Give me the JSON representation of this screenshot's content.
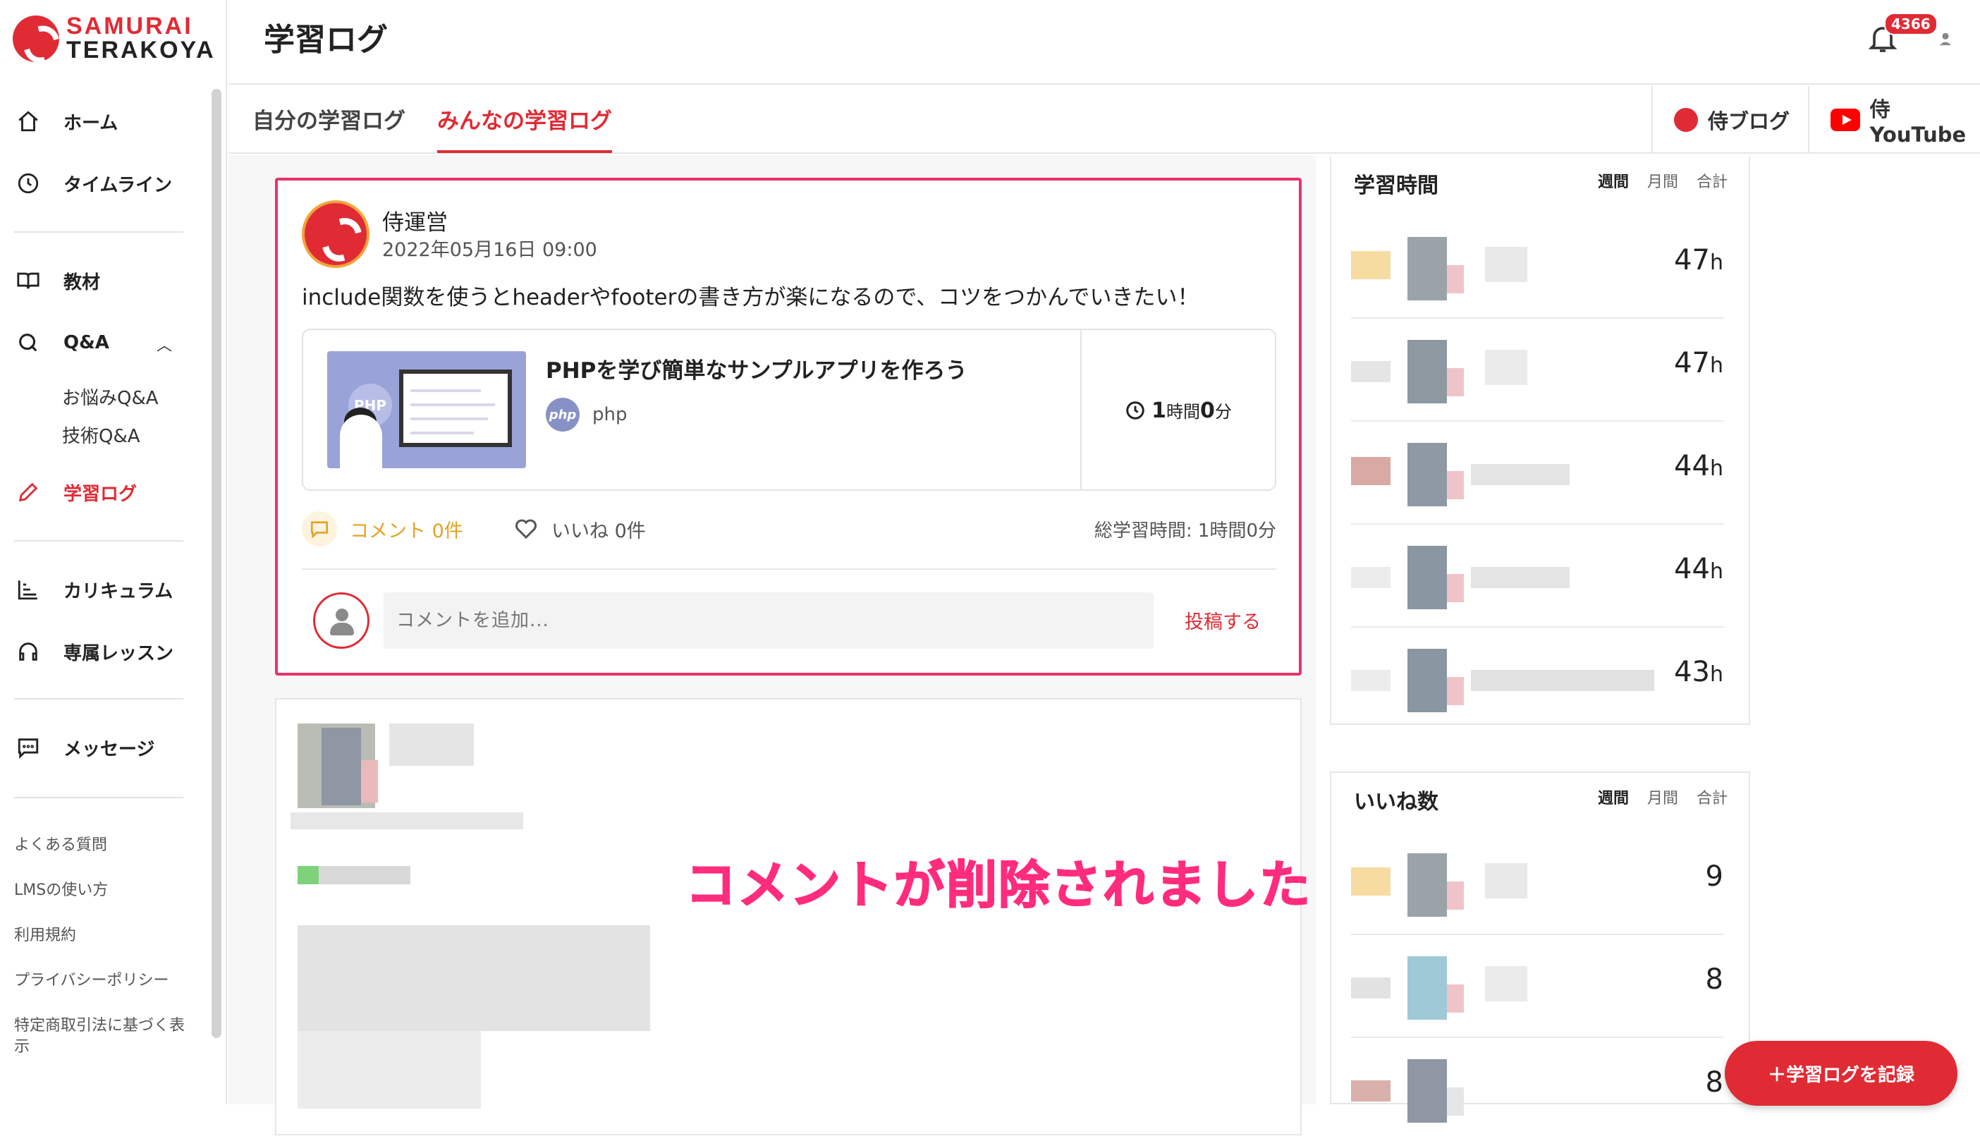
{
  "brand": {
    "line1": "SAMURAI",
    "line2": "TERAKOYA"
  },
  "header": {
    "title": "学習ログ",
    "notification_count": "4366"
  },
  "nav": {
    "home": "ホーム",
    "timeline": "タイムライン",
    "materials": "教材",
    "qa": "Q&A",
    "qa_worries": "お悩みQ&A",
    "qa_tech": "技術Q&A",
    "log": "学習ログ",
    "curriculum": "カリキュラム",
    "lesson": "専属レッスン",
    "message": "メッセージ"
  },
  "footer_links": {
    "faq": "よくある質問",
    "howto": "LMSの使い方",
    "terms": "利用規約",
    "privacy": "プライバシーポリシー",
    "law": "特定商取引法に基づく表示"
  },
  "tabs": {
    "mine": "自分の学習ログ",
    "all": "みんなの学習ログ"
  },
  "external": {
    "blog": "侍ブログ",
    "youtube": "侍YouTube"
  },
  "post": {
    "author": "侍運営",
    "date": "2022年05月16日 09:00",
    "text": "include関数を使うとheaderやfooterの書き方が楽になるので、コツをつかんでいきたい！",
    "course_title": "PHPを学び簡単なサンプルアプリを作ろう",
    "course_tag": "php",
    "course_tag_icon": "php",
    "thumb_label": "PHP",
    "time_h": "1",
    "time_h_unit": "時間",
    "time_m": "0",
    "time_m_unit": "分",
    "comments": "コメント 0件",
    "likes": "いいね 0件",
    "total": "総学習時間: 1時間0分",
    "comment_placeholder": "コメントを追加...",
    "submit": "投稿する"
  },
  "notice": "コメントが削除されました",
  "ranking_time": {
    "title": "学習時間",
    "tabs": [
      "週間",
      "月間",
      "合計"
    ],
    "values": [
      "47",
      "47",
      "44",
      "44",
      "43"
    ],
    "unit": "h"
  },
  "ranking_likes": {
    "title": "いいね数",
    "tabs": [
      "週間",
      "月間",
      "合計"
    ],
    "values": [
      "9",
      "8",
      "8"
    ]
  },
  "fab": "＋学習ログを記録",
  "colors": {
    "accent": "#e02b35",
    "highlight": "#e8336b",
    "notice": "#ff2c7d",
    "comment": "#e4a326"
  }
}
